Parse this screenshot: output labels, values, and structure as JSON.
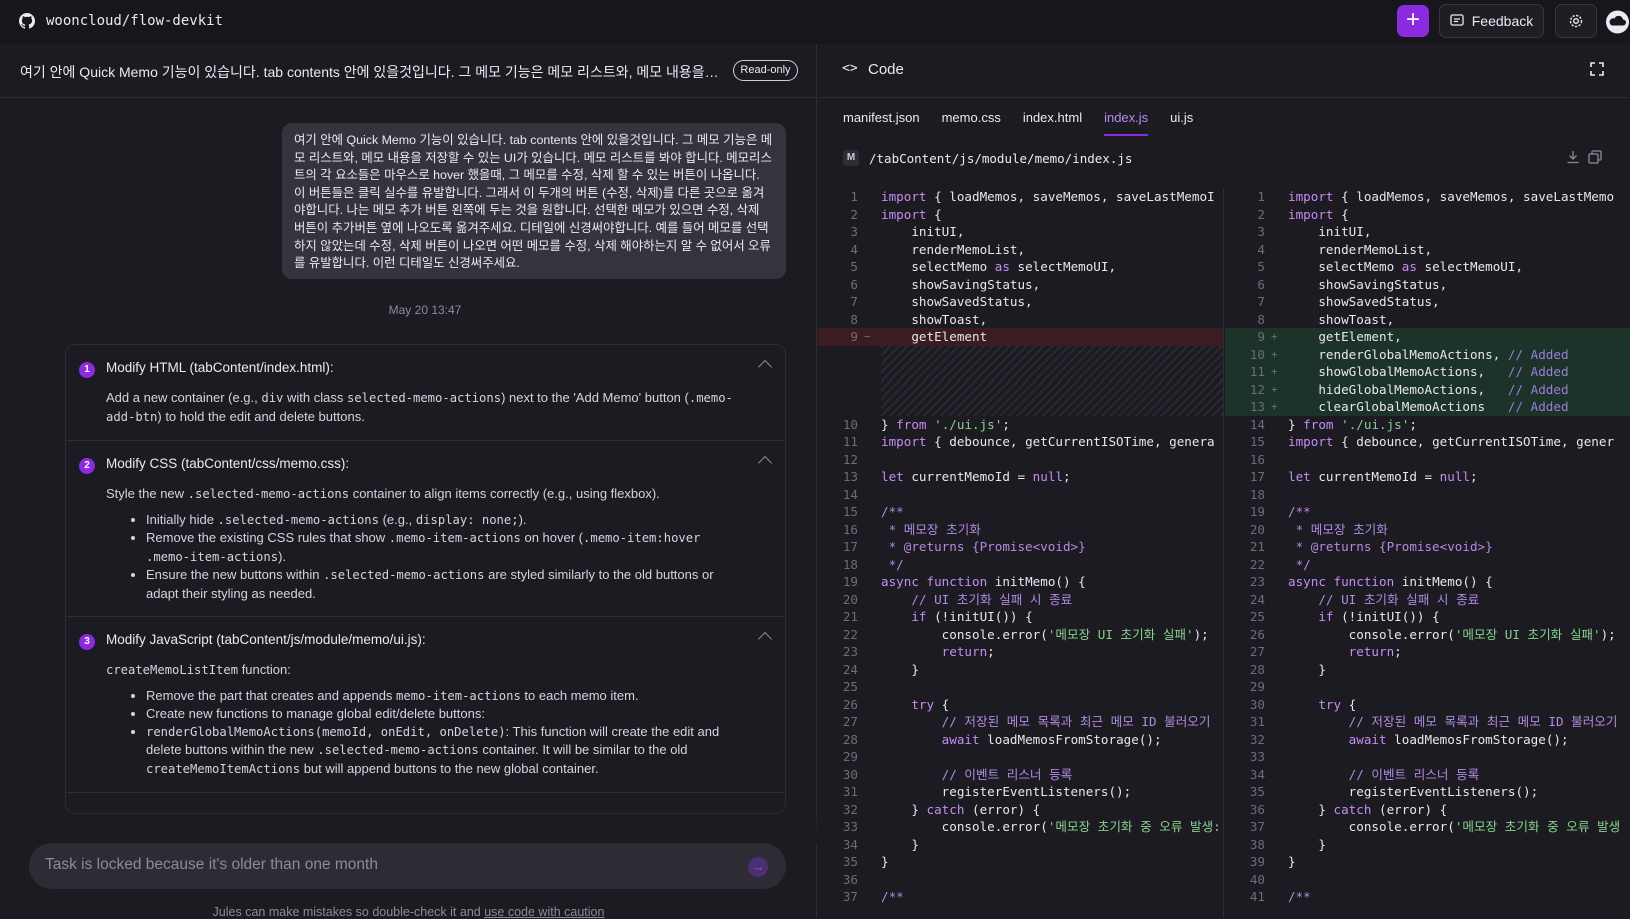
{
  "topbar": {
    "repo": "wooncloud/flow-devkit",
    "new_task_label": "+",
    "feedback_label": "Feedback",
    "icons": [
      "github-icon",
      "plus-icon",
      "feedback-icon",
      "gear-icon",
      "cloud-icon"
    ]
  },
  "task": {
    "title": "여기 안에 Quick Memo 기능이 있습니다. tab contents 안에 있을것입니다. 그 메모 기능은 메모 리스트와, 메모 내용을 저장...",
    "readonly_badge": "Read-only",
    "message": "여기 안에 Quick Memo 기능이 있습니다. tab contents 안에 있을것입니다. 그 메모 기능은 메모 리스트와, 메모 내용을 저장할 수 있는 UI가 있습니다. 메모 리스트를 봐야 합니다. 메모리스트의 각 요소들은 마우스로 hover 했을때, 그 메모를 수정, 삭제 할 수 있는 버튼이 나옵니다. 이 버튼들은 클릭 실수를 유발합니다. 그래서 이 두개의 버튼 (수정, 삭제)를 다른 곳으로 옮겨야합니다. 나는 메모 추가 버튼 왼쪽에 두는 것을 원합니다. 선택한 메모가 있으면 수정, 삭제 버튼이 추가버튼 옆에 나오도록 옮겨주세요. 디테일에 신경써야합니다. 예를 들어 메모를 선택하지 않았는데 수정, 삭제 버튼이 나오면 어떤 메모를 수정, 삭제 해야하는지 알 수 없어서 오류를 유발합니다. 이런 디테일도 신경써주세요.",
    "timestamp": "May 20 13:47"
  },
  "plan": {
    "steps": [
      {
        "num": "1",
        "title": "Modify HTML (tabContent/index.html):",
        "body_a": "Add a new container (e.g., ",
        "code_a": "div",
        "body_b": " with class ",
        "code_b": "selected-memo-actions",
        "body_c": ") next to the 'Add Memo' button (",
        "code_c": ".memo-add-btn",
        "body_d": ") to hold the edit and delete buttons."
      },
      {
        "num": "2",
        "title": "Modify CSS (tabContent/css/memo.css):",
        "intro_a": "Style the new ",
        "intro_code": ".selected-memo-actions",
        "intro_b": " container to align items correctly (e.g., using flexbox).",
        "b1_a": "Initially hide ",
        "b1_code1": ".selected-memo-actions",
        "b1_b": " (e.g., ",
        "b1_code2": "display: none;",
        "b1_c": ").",
        "b2_a": "Remove the existing CSS rules that show ",
        "b2_code1": ".memo-item-actions",
        "b2_b": " on hover (",
        "b2_code2": ".memo-item:hover .memo-item-actions",
        "b2_c": ").",
        "b3_a": "Ensure the new buttons within ",
        "b3_code": ".selected-memo-actions",
        "b3_b": " are styled similarly to the old buttons or adapt their styling as needed."
      },
      {
        "num": "3",
        "title": "Modify JavaScript (tabContent/js/module/memo/ui.js):",
        "intro_code": "createMemoListItem",
        "intro_b": " function:",
        "b1_a": "Remove the part that creates and appends ",
        "b1_code": "memo-item-actions",
        "b1_b": " to each memo item.",
        "b2": "Create new functions to manage global edit/delete buttons:",
        "b3_code1": "renderGlobalMemoActions(memoId, onEdit, onDelete)",
        "b3_a": ": This function will create the edit and delete buttons within the new ",
        "b3_code2": ".selected-memo-actions",
        "b3_b": " container. It will be similar to the old ",
        "b3_code3": "createMemoItemActions",
        "b3_c": " but will append buttons to the new global container."
      }
    ]
  },
  "input": {
    "placeholder": "Task is locked because it's older than one month",
    "send_icon": "arrow-right-icon"
  },
  "disclaimer": {
    "text": "Jules can make mistakes so double-check it and ",
    "link": "use code with caution"
  },
  "code": {
    "header": "Code",
    "header_icon": "code-brackets-icon",
    "tabs": [
      "manifest.json",
      "memo.css",
      "index.html",
      "index.js",
      "ui.js"
    ],
    "active_tab": "index.js",
    "file_status": "M",
    "file_path": "/tabContent/js/module/memo/index.js"
  },
  "diff": {
    "left": [
      {
        "n": "1",
        "t": "normal",
        "h": "<span class='k'>import</span> { loadMemos, saveMemos, saveLastMemoI"
      },
      {
        "n": "2",
        "t": "normal",
        "h": "<span class='k'>import</span> {"
      },
      {
        "n": "3",
        "t": "normal",
        "h": "    initUI,"
      },
      {
        "n": "4",
        "t": "normal",
        "h": "    renderMemoList,"
      },
      {
        "n": "5",
        "t": "normal",
        "h": "    selectMemo <span class='k'>as</span> selectMemoUI,"
      },
      {
        "n": "6",
        "t": "normal",
        "h": "    showSavingStatus,"
      },
      {
        "n": "7",
        "t": "normal",
        "h": "    showSavedStatus,"
      },
      {
        "n": "8",
        "t": "normal",
        "h": "    showToast,"
      },
      {
        "n": "9",
        "t": "del",
        "h": "    getElement"
      },
      {
        "n": "",
        "t": "filler",
        "h": ""
      },
      {
        "n": "",
        "t": "filler",
        "h": ""
      },
      {
        "n": "",
        "t": "filler",
        "h": ""
      },
      {
        "n": "",
        "t": "filler",
        "h": ""
      },
      {
        "n": "10",
        "t": "normal",
        "h": "} <span class='k'>from</span> <span class='s'>'./ui.js'</span>;"
      },
      {
        "n": "11",
        "t": "normal",
        "h": "<span class='k'>import</span> { debounce, getCurrentISOTime, genera"
      },
      {
        "n": "12",
        "t": "normal",
        "h": ""
      },
      {
        "n": "13",
        "t": "normal",
        "h": "<span class='k'>let</span> currentMemoId = <span class='k'>null</span>;"
      },
      {
        "n": "14",
        "t": "normal",
        "h": ""
      },
      {
        "n": "15",
        "t": "normal",
        "h": "<span class='c'>/**</span>"
      },
      {
        "n": "16",
        "t": "normal",
        "h": "<span class='c'> * 메모장 초기화</span>"
      },
      {
        "n": "17",
        "t": "normal",
        "h": "<span class='c'> * @returns {Promise&lt;void&gt;}</span>"
      },
      {
        "n": "18",
        "t": "normal",
        "h": "<span class='c'> */</span>"
      },
      {
        "n": "19",
        "t": "normal",
        "h": "<span class='k'>async function</span> initMemo() {"
      },
      {
        "n": "20",
        "t": "normal",
        "h": "    <span class='c'>// UI 초기화 실패 시 종료</span>"
      },
      {
        "n": "21",
        "t": "normal",
        "h": "    <span class='k'>if</span> (!initUI()) {"
      },
      {
        "n": "22",
        "t": "normal",
        "h": "        console.error(<span class='s'>'메모장 UI 초기화 실패'</span>);"
      },
      {
        "n": "23",
        "t": "normal",
        "h": "        <span class='k'>return</span>;"
      },
      {
        "n": "24",
        "t": "normal",
        "h": "    }"
      },
      {
        "n": "25",
        "t": "normal",
        "h": ""
      },
      {
        "n": "26",
        "t": "normal",
        "h": "    <span class='k'>try</span> {"
      },
      {
        "n": "27",
        "t": "normal",
        "h": "        <span class='c'>// 저장된 메모 목록과 최근 메모 ID 불러오기</span>"
      },
      {
        "n": "28",
        "t": "normal",
        "h": "        <span class='k'>await</span> loadMemosFromStorage();"
      },
      {
        "n": "29",
        "t": "normal",
        "h": ""
      },
      {
        "n": "30",
        "t": "normal",
        "h": "        <span class='c'>// 이벤트 리스너 등록</span>"
      },
      {
        "n": "31",
        "t": "normal",
        "h": "        registerEventListeners();"
      },
      {
        "n": "32",
        "t": "normal",
        "h": "    } <span class='k'>catch</span> (error) {"
      },
      {
        "n": "33",
        "t": "normal",
        "h": "        console.error(<span class='s'>'메모장 초기화 중 오류 발생:</span>"
      },
      {
        "n": "34",
        "t": "normal",
        "h": "    }"
      },
      {
        "n": "35",
        "t": "normal",
        "h": "}"
      },
      {
        "n": "36",
        "t": "normal",
        "h": ""
      },
      {
        "n": "37",
        "t": "normal",
        "h": "<span class='c'>/**</span>"
      }
    ],
    "right": [
      {
        "n": "1",
        "t": "normal",
        "h": "<span class='k'>import</span> { loadMemos, saveMemos, saveLastMemo"
      },
      {
        "n": "2",
        "t": "normal",
        "h": "<span class='k'>import</span> {"
      },
      {
        "n": "3",
        "t": "normal",
        "h": "    initUI,"
      },
      {
        "n": "4",
        "t": "normal",
        "h": "    renderMemoList,"
      },
      {
        "n": "5",
        "t": "normal",
        "h": "    selectMemo <span class='k'>as</span> selectMemoUI,"
      },
      {
        "n": "6",
        "t": "normal",
        "h": "    showSavingStatus,"
      },
      {
        "n": "7",
        "t": "normal",
        "h": "    showSavedStatus,"
      },
      {
        "n": "8",
        "t": "normal",
        "h": "    showToast,"
      },
      {
        "n": "9",
        "t": "add",
        "h": "    getElement,"
      },
      {
        "n": "10",
        "t": "add",
        "h": "    renderGlobalMemoActions, <span class='cm'>// Added</span>"
      },
      {
        "n": "11",
        "t": "add",
        "h": "    showGlobalMemoActions,   <span class='cm'>// Added</span>"
      },
      {
        "n": "12",
        "t": "add",
        "h": "    hideGlobalMemoActions,   <span class='cm'>// Added</span>"
      },
      {
        "n": "13",
        "t": "add",
        "h": "    clearGlobalMemoActions   <span class='cm'>// Added</span>"
      },
      {
        "n": "14",
        "t": "normal",
        "h": "} <span class='k'>from</span> <span class='s'>'./ui.js'</span>;"
      },
      {
        "n": "15",
        "t": "normal",
        "h": "<span class='k'>import</span> { debounce, getCurrentISOTime, gener"
      },
      {
        "n": "16",
        "t": "normal",
        "h": ""
      },
      {
        "n": "17",
        "t": "normal",
        "h": "<span class='k'>let</span> currentMemoId = <span class='k'>null</span>;"
      },
      {
        "n": "18",
        "t": "normal",
        "h": ""
      },
      {
        "n": "19",
        "t": "normal",
        "h": "<span class='c'>/**</span>"
      },
      {
        "n": "20",
        "t": "normal",
        "h": "<span class='c'> * 메모장 초기화</span>"
      },
      {
        "n": "21",
        "t": "normal",
        "h": "<span class='c'> * @returns {Promise&lt;void&gt;}</span>"
      },
      {
        "n": "22",
        "t": "normal",
        "h": "<span class='c'> */</span>"
      },
      {
        "n": "23",
        "t": "normal",
        "h": "<span class='k'>async function</span> initMemo() {"
      },
      {
        "n": "24",
        "t": "normal",
        "h": "    <span class='c'>// UI 초기화 실패 시 종료</span>"
      },
      {
        "n": "25",
        "t": "normal",
        "h": "    <span class='k'>if</span> (!initUI()) {"
      },
      {
        "n": "26",
        "t": "normal",
        "h": "        console.error(<span class='s'>'메모장 UI 초기화 실패'</span>);"
      },
      {
        "n": "27",
        "t": "normal",
        "h": "        <span class='k'>return</span>;"
      },
      {
        "n": "28",
        "t": "normal",
        "h": "    }"
      },
      {
        "n": "29",
        "t": "normal",
        "h": ""
      },
      {
        "n": "30",
        "t": "normal",
        "h": "    <span class='k'>try</span> {"
      },
      {
        "n": "31",
        "t": "normal",
        "h": "        <span class='c'>// 저장된 메모 목록과 최근 메모 ID 불러오기</span>"
      },
      {
        "n": "32",
        "t": "normal",
        "h": "        <span class='k'>await</span> loadMemosFromStorage();"
      },
      {
        "n": "33",
        "t": "normal",
        "h": ""
      },
      {
        "n": "34",
        "t": "normal",
        "h": "        <span class='c'>// 이벤트 리스너 등록</span>"
      },
      {
        "n": "35",
        "t": "normal",
        "h": "        registerEventListeners();"
      },
      {
        "n": "36",
        "t": "normal",
        "h": "    } <span class='k'>catch</span> (error) {"
      },
      {
        "n": "37",
        "t": "normal",
        "h": "        console.error(<span class='s'>'메모장 초기화 중 오류 발생</span>"
      },
      {
        "n": "38",
        "t": "normal",
        "h": "    }"
      },
      {
        "n": "39",
        "t": "normal",
        "h": "}"
      },
      {
        "n": "40",
        "t": "normal",
        "h": ""
      },
      {
        "n": "41",
        "t": "normal",
        "h": "<span class='c'>/**</span>"
      }
    ]
  },
  "colors": {
    "accent": "#8a2be2",
    "bg": "#1c1b22",
    "add": "#1b3328",
    "del": "#3a1c22"
  }
}
